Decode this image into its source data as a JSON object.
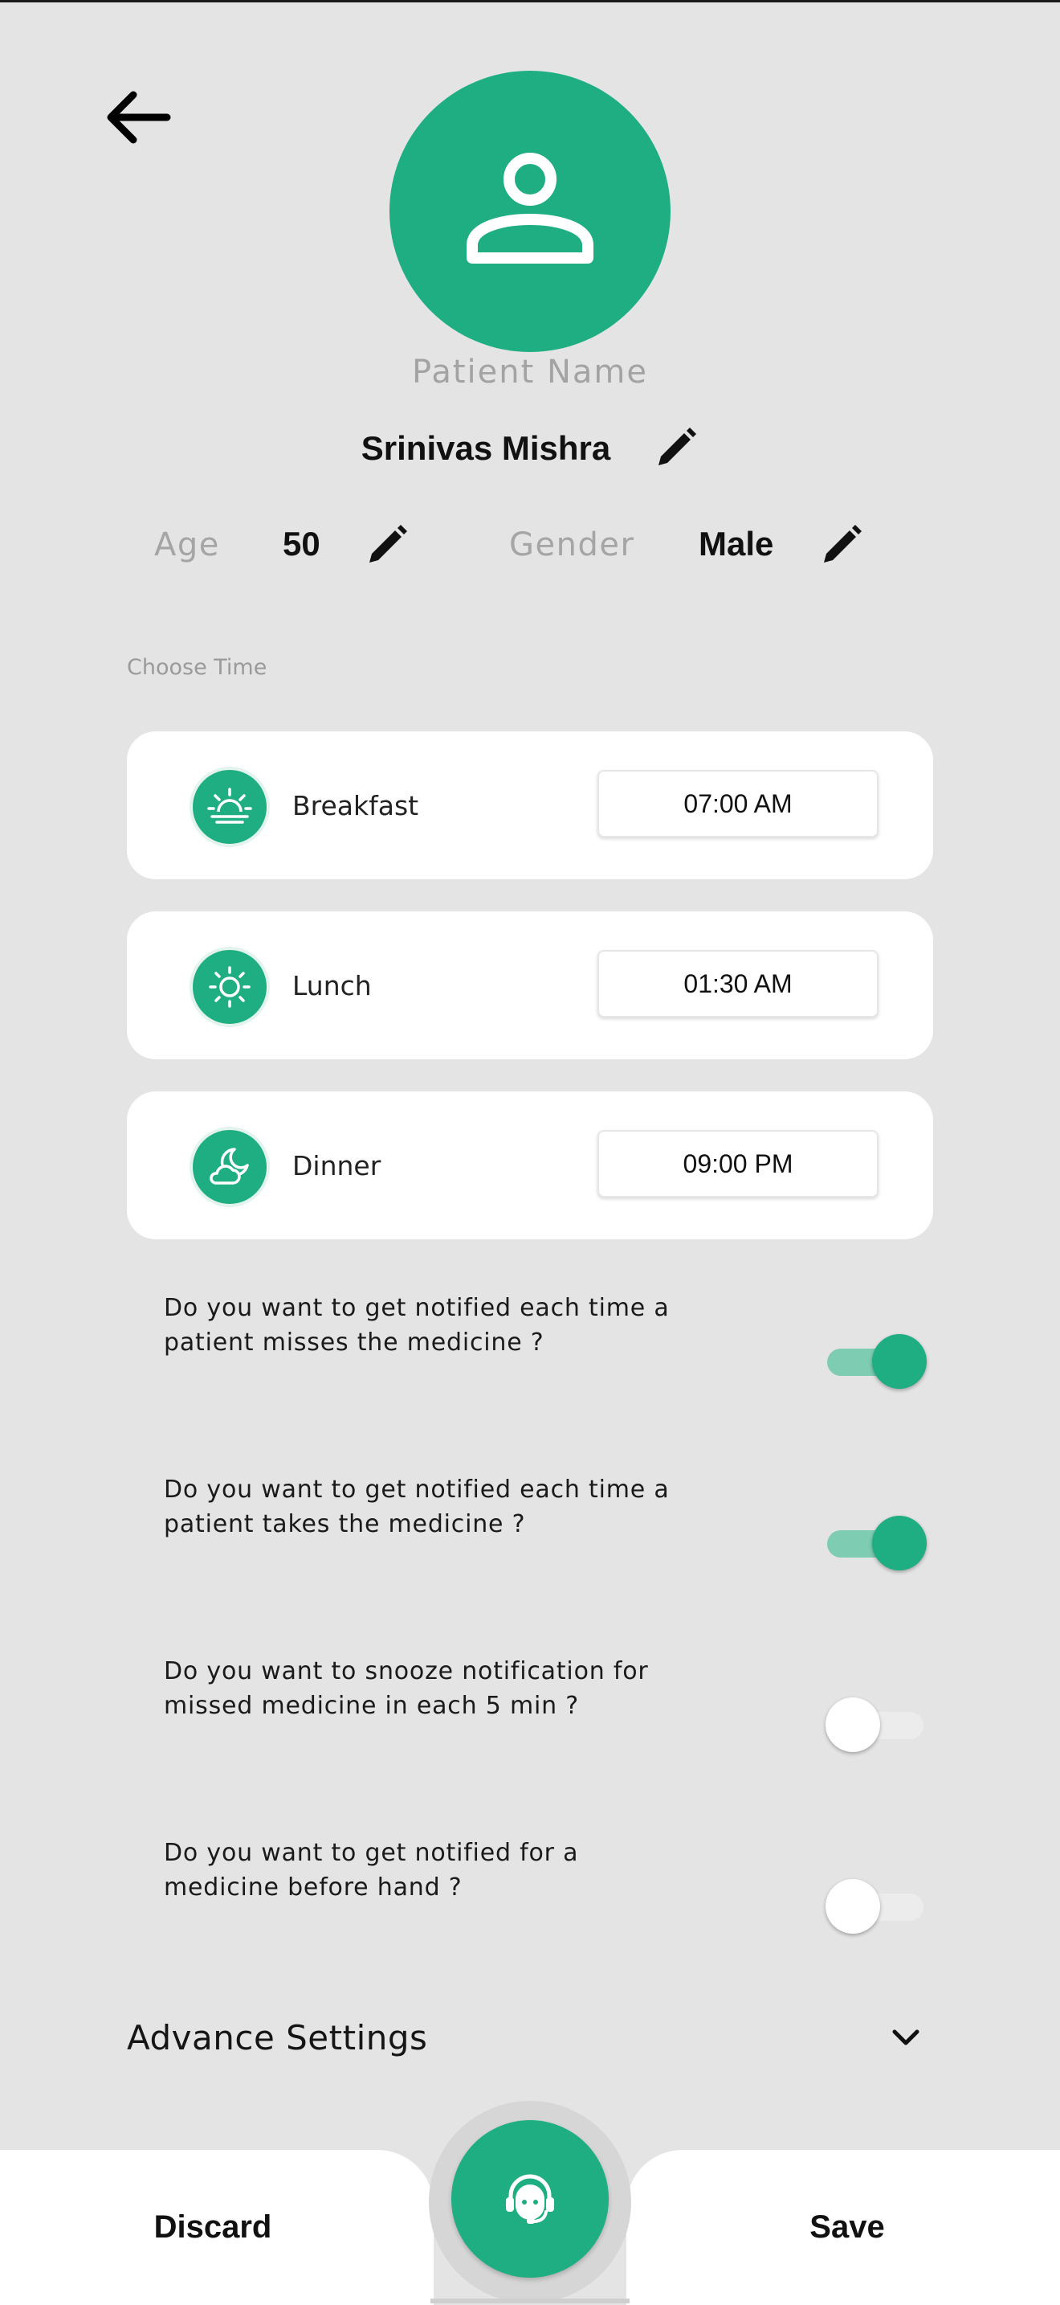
{
  "header": {
    "patient_name_label": "Patient Name",
    "patient_name": "Srinivas Mishra",
    "age_label": "Age",
    "age_value": "50",
    "gender_label": "Gender",
    "gender_value": "Male"
  },
  "schedule": {
    "label": "Choose Time",
    "meals": [
      {
        "label": "Breakfast",
        "time": "07:00 AM",
        "icon": "sunrise-icon"
      },
      {
        "label": "Lunch",
        "time": "01:30 AM",
        "icon": "sun-icon"
      },
      {
        "label": "Dinner",
        "time": "09:00 PM",
        "icon": "moon-cloud-icon"
      }
    ]
  },
  "notifications": [
    {
      "line1": "Do you want to get notified each time a",
      "line2": "patient misses the medicine ?",
      "enabled": true
    },
    {
      "line1": "Do you want to get notified each time a",
      "line2": "patient takes the medicine ?",
      "enabled": true
    },
    {
      "line1": "Do you want to snooze notification for",
      "line2": "missed medicine in each 5 min ?",
      "enabled": false
    },
    {
      "line1": "Do you want to get notified for a",
      "line2": "medicine before hand ?",
      "enabled": false
    }
  ],
  "advance_settings": {
    "label": "Advance Settings"
  },
  "bottom_bar": {
    "discard_label": "Discard",
    "save_label": "Save",
    "center_icon": "support-agent-icon"
  },
  "colors": {
    "accent": "#1fae81",
    "accent_light": "#7ecdb3",
    "background": "#e4e4e4",
    "card": "#ffffff"
  }
}
